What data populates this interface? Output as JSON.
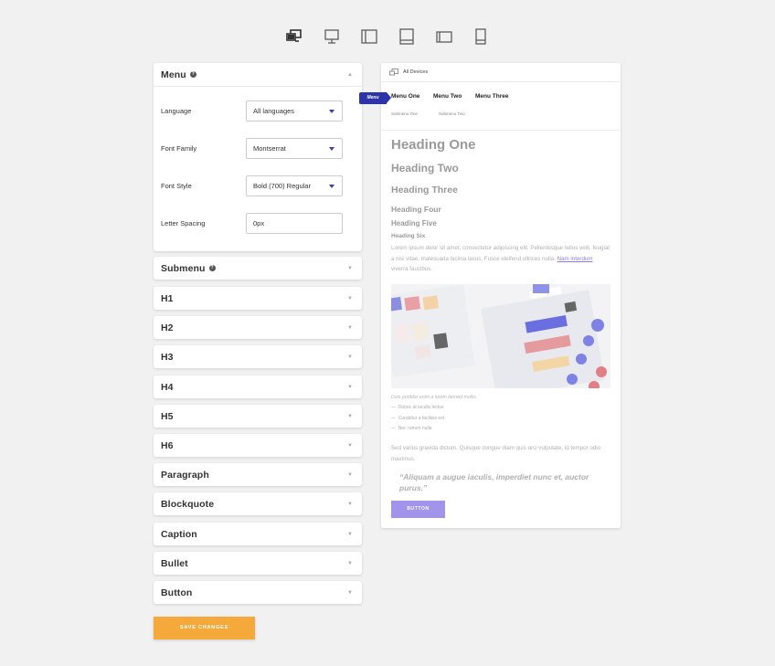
{
  "devices": [
    {
      "icon": "all-devices-icon",
      "active": true
    },
    {
      "icon": "desktop-icon",
      "active": false
    },
    {
      "icon": "laptop-icon",
      "active": false
    },
    {
      "icon": "tablet-landscape-icon",
      "active": false
    },
    {
      "icon": "tablet-portrait-icon",
      "active": false
    },
    {
      "icon": "mobile-icon",
      "active": false
    }
  ],
  "menu_panel": {
    "title": "Menu",
    "fields": [
      {
        "label": "Language",
        "value": "All languages"
      },
      {
        "label": "Font Family",
        "value": "Montserrat"
      },
      {
        "label": "Font Style",
        "value": "Bold (700) Regular"
      },
      {
        "label": "Letter Spacing",
        "value": "0px"
      }
    ]
  },
  "panels": [
    "Submenu",
    "H1",
    "H2",
    "H3",
    "H4",
    "H5",
    "H6",
    "Paragraph",
    "Blockquote",
    "Caption",
    "Bullet",
    "Button"
  ],
  "save_label": "SAVE CHANGES",
  "preview": {
    "device_label": "All Devices",
    "badge": "Menu",
    "nav": [
      "Menu One",
      "Menu Two",
      "Menu Three"
    ],
    "subnav": [
      "Submenu One",
      "Submenu Two"
    ],
    "headings": [
      "Heading One",
      "Heading Two",
      "Heading Three",
      "Heading Four",
      "Heading Five",
      "Heading Six"
    ],
    "paragraph1_a": "Lorem ipsum dolor sit amet, consectetur adipiscing elit. Pellentesque tellus velit, feugiat a nisi vitae, malesuada lacinia lacus. Fusce eleifend ultrices nulla.",
    "paragraph1_link": "Nam interdum",
    "paragraph1_b": "viverra faucibus.",
    "caption": "Duis porttitor enim a lorem laoreet mollis.",
    "bullets": [
      "Donec at iaculis lectus",
      "Curabitur a facilisis est",
      "Nec rutrum nulla"
    ],
    "bullet_marker": "—",
    "paragraph2": "Sed varius gravida dictum. Quisque congue diam quis orci vulputate, id tempor odio maximus.",
    "quote": "“Aliquam a augue iaculis, imperdiet nunc et, auctor purus.”",
    "button": "BUTTON"
  },
  "colors": {
    "accent": "#2d33a8",
    "save": "#f5a93b",
    "preview_button": "#a294ea",
    "link": "#8a7fe0"
  }
}
